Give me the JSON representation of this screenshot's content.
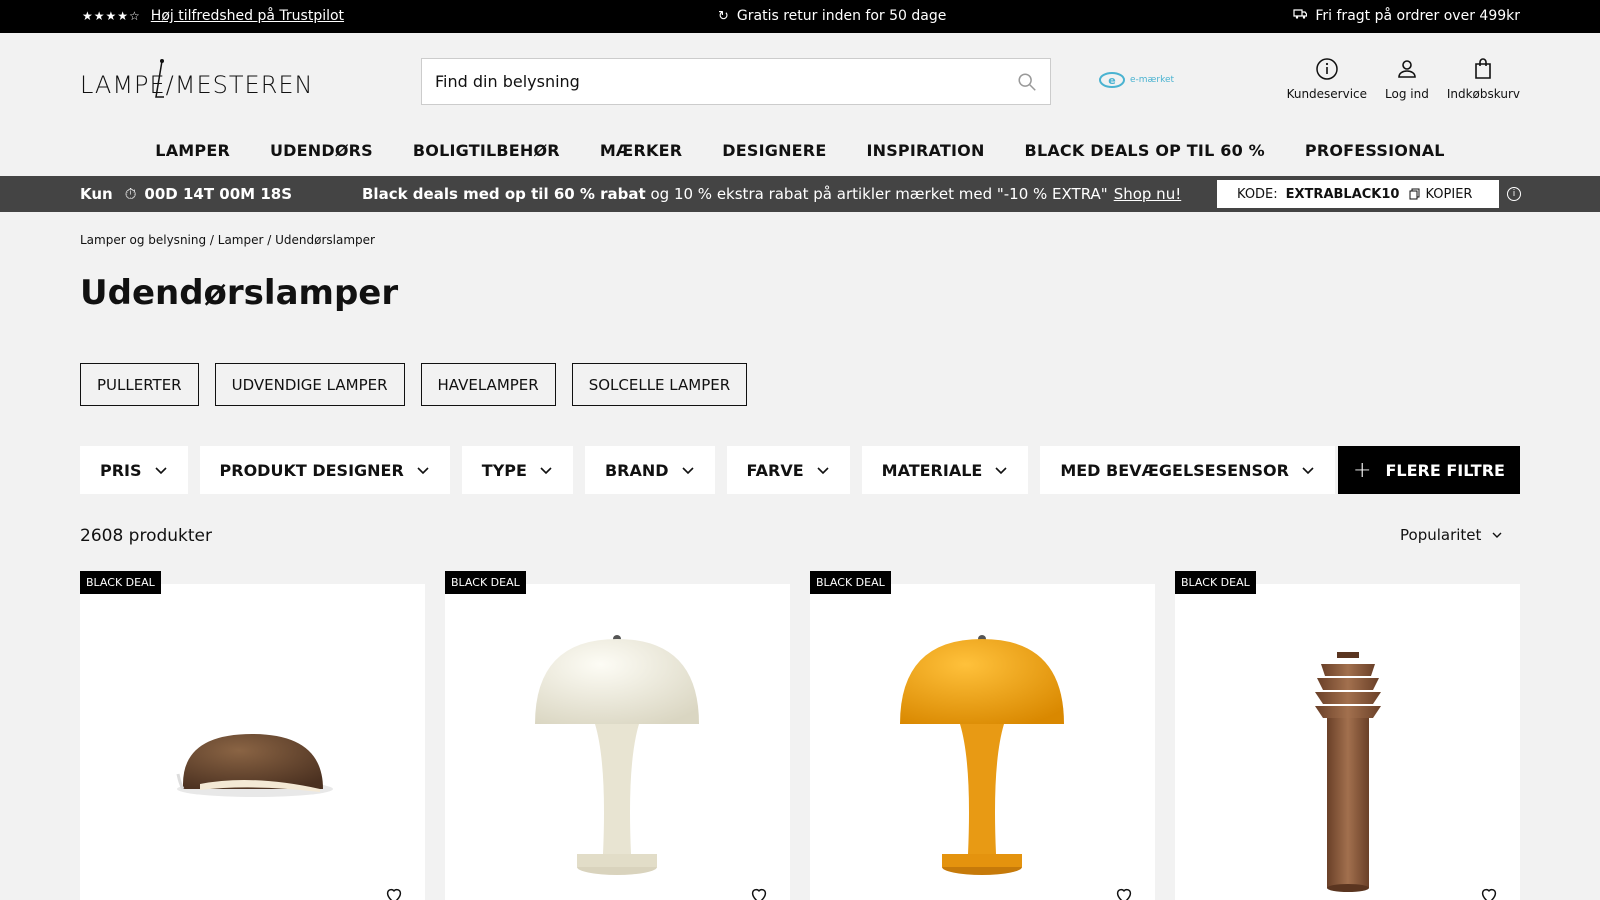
{
  "topbar": {
    "stars": "★★★★☆",
    "trustpilot": "Høj tilfredshed på Trustpilot",
    "returns": "Gratis retur inden for 50 dage",
    "shipping": "Fri fragt på ordrer over 499kr"
  },
  "header": {
    "logo_text": "LAMPE/MESTEREN",
    "search_placeholder": "Find din belysning",
    "emarket": "e-mærket",
    "icons": {
      "service": "Kundeservice",
      "login": "Log ind",
      "cart": "Indkøbskurv"
    }
  },
  "nav": [
    "LAMPER",
    "UDENDØRS",
    "BOLIGTILBEHØR",
    "MÆRKER",
    "DESIGNERE",
    "INSPIRATION",
    "BLACK DEALS OP TIL 60 %",
    "PROFESSIONAL"
  ],
  "promo": {
    "prefix": "Kun",
    "countdown": "00D 14T 00M 18S",
    "bold": "Black deals med op til 60 % rabat",
    "rest": " og 10 % ekstra rabat på artikler mærket med \"-10 % EXTRA\"",
    "link": "Shop nu!",
    "code_label": "KODE:",
    "code_value": "EXTRABLACK10",
    "copy_label": "KOPIER"
  },
  "breadcrumb": "Lamper og belysning / Lamper / Udendørslamper",
  "page_title": "Udendørslamper",
  "chips": [
    "PULLERTER",
    "UDVENDIGE LAMPER",
    "HAVELAMPER",
    "SOLCELLE LAMPER"
  ],
  "filters": [
    "PRIS",
    "PRODUKT DESIGNER",
    "TYPE",
    "BRAND",
    "FARVE",
    "MATERIALE",
    "MED BEVÆGELSESENSOR"
  ],
  "more_filters": "FLERE FILTRE",
  "product_count": "2608 produkter",
  "sort": "Popularitet",
  "products": [
    {
      "badge": "BLACK DEAL",
      "color": "#6b4a32"
    },
    {
      "badge": "BLACK DEAL",
      "color": "#ece9dc"
    },
    {
      "badge": "BLACK DEAL",
      "color": "#f0a51c"
    },
    {
      "badge": "BLACK DEAL",
      "color": "#8a5b3c"
    }
  ]
}
